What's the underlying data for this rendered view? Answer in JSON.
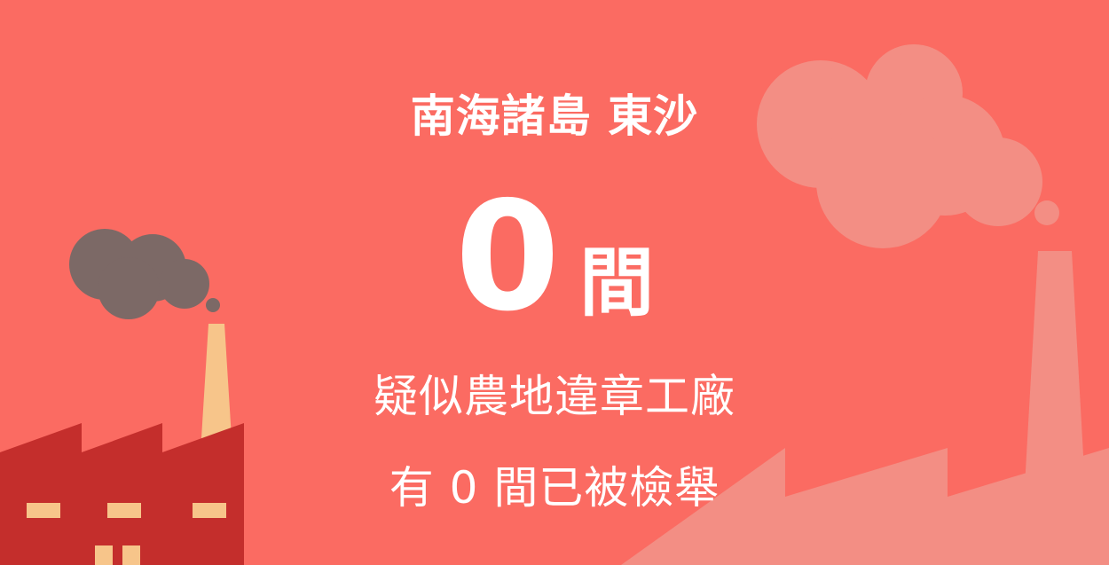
{
  "colors": {
    "background": "#fb6b62",
    "factory": "#c42e2c",
    "chimney": "#f7c58a",
    "window": "#f7c58a",
    "dark_smoke": "#7c6966",
    "faded": "#f38e84"
  },
  "headline": {
    "region": "南海諸島 東沙",
    "count": "0",
    "unit": "間",
    "description": "疑似農地違章工廠"
  },
  "reported": {
    "prefix": "有",
    "count": "0",
    "suffix": "間已被檢舉"
  },
  "icons": [
    "factory-icon",
    "smoke-cloud-icon",
    "chimney-icon"
  ]
}
